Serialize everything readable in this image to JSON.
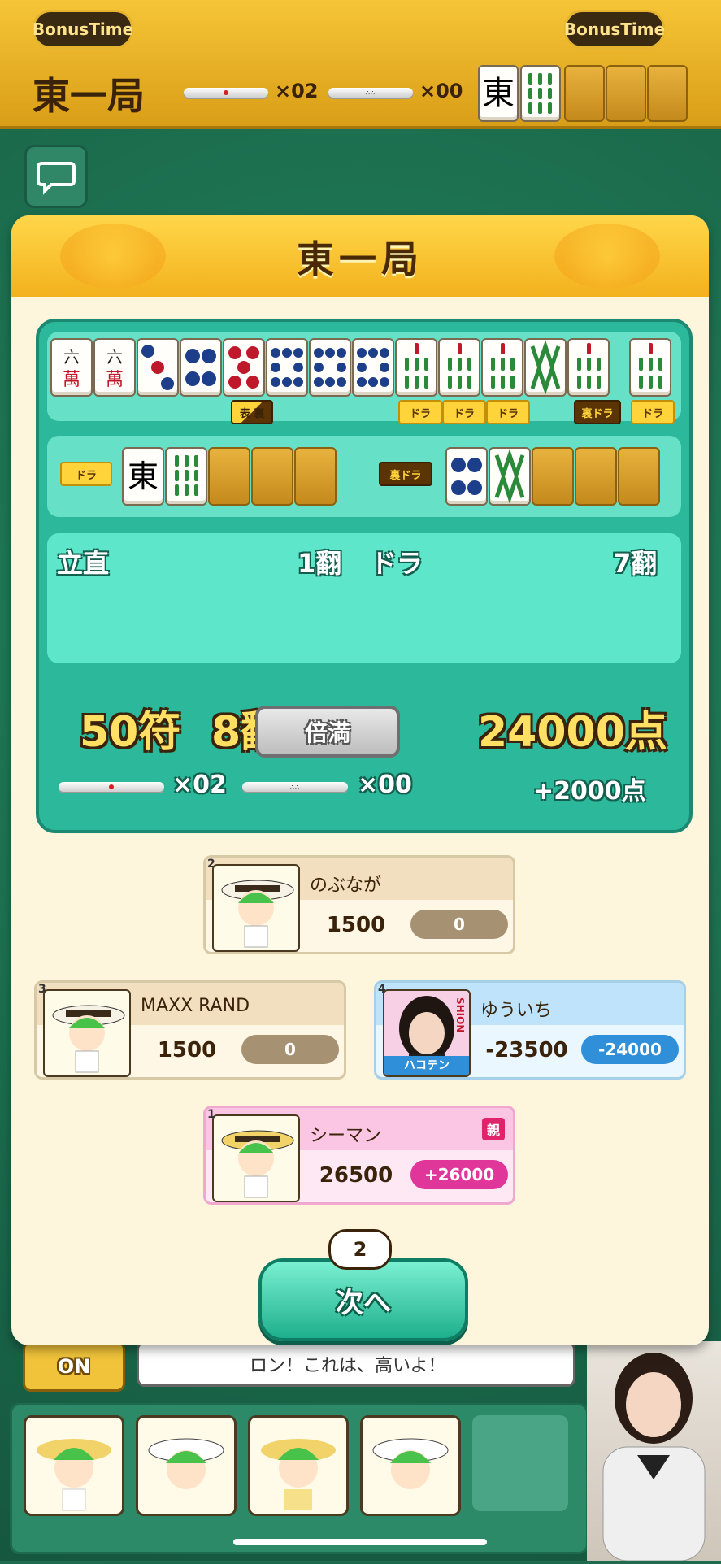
{
  "header": {
    "bonus_left": "BonusTime",
    "bonus_right": "BonusTime",
    "round": "東一局",
    "riichi_count": "×02",
    "honba_count": "×00",
    "dora_tile": "東"
  },
  "modal": {
    "title": "東一局",
    "hand_tiles": [
      "六萬",
      "六萬",
      "3p",
      "4p",
      "5p",
      "8p",
      "8p",
      "8p",
      "6s",
      "6s",
      "6s",
      "7s",
      "8s",
      "6s"
    ],
    "hand_indicators": [
      {
        "label": "表 裏",
        "type": "aka"
      },
      {
        "label": "ドラ",
        "type": "dora"
      },
      {
        "label": "ドラ",
        "type": "dora"
      },
      {
        "label": "ドラ",
        "type": "dora"
      },
      {
        "label": "裏ドラ",
        "type": "ura"
      },
      {
        "label": "ドラ",
        "type": "dora"
      }
    ],
    "dora_label": "ドラ",
    "dora_tiles": [
      "東",
      "5s"
    ],
    "uradora_label": "裏ドラ",
    "uradora_tiles": [
      "4p",
      "7s"
    ],
    "yaku": [
      {
        "name": "立直",
        "han": "1翻",
        "extra": "ドラ",
        "extra_han": "7翻"
      }
    ],
    "fu": "50符",
    "total_han": "8翻",
    "limit_name": "倍満",
    "points": "24000点",
    "riichi_sticks": "×02",
    "honba_sticks": "×00",
    "bonus_points": "+2000点"
  },
  "players": [
    {
      "rank": "2",
      "name": "のぶなが",
      "score": "1500",
      "delta": "0",
      "style": "tan",
      "dealer": false
    },
    {
      "rank": "3",
      "name": "MAXX RAND",
      "score": "1500",
      "delta": "0",
      "style": "tan",
      "dealer": false
    },
    {
      "rank": "4",
      "name": "ゆういち",
      "score": "-23500",
      "delta": "-24000",
      "style": "blue",
      "dealer": false,
      "badge": "ハコテン",
      "logo": "SHION"
    },
    {
      "rank": "1",
      "name": "シーマン",
      "score": "26500",
      "delta": "+26000",
      "style": "pink",
      "dealer": true,
      "dealer_label": "親"
    }
  ],
  "next": {
    "label": "次へ",
    "counter": "2"
  },
  "footer": {
    "on_label": "ON",
    "speech": "ロン！これは、高いよ！"
  },
  "colors": {
    "teal": "#2cb89a",
    "gold": "#f3b11d",
    "pink_delta": "#e0369a",
    "blue_delta": "#2f8fd8",
    "tan_delta": "#a69273"
  }
}
